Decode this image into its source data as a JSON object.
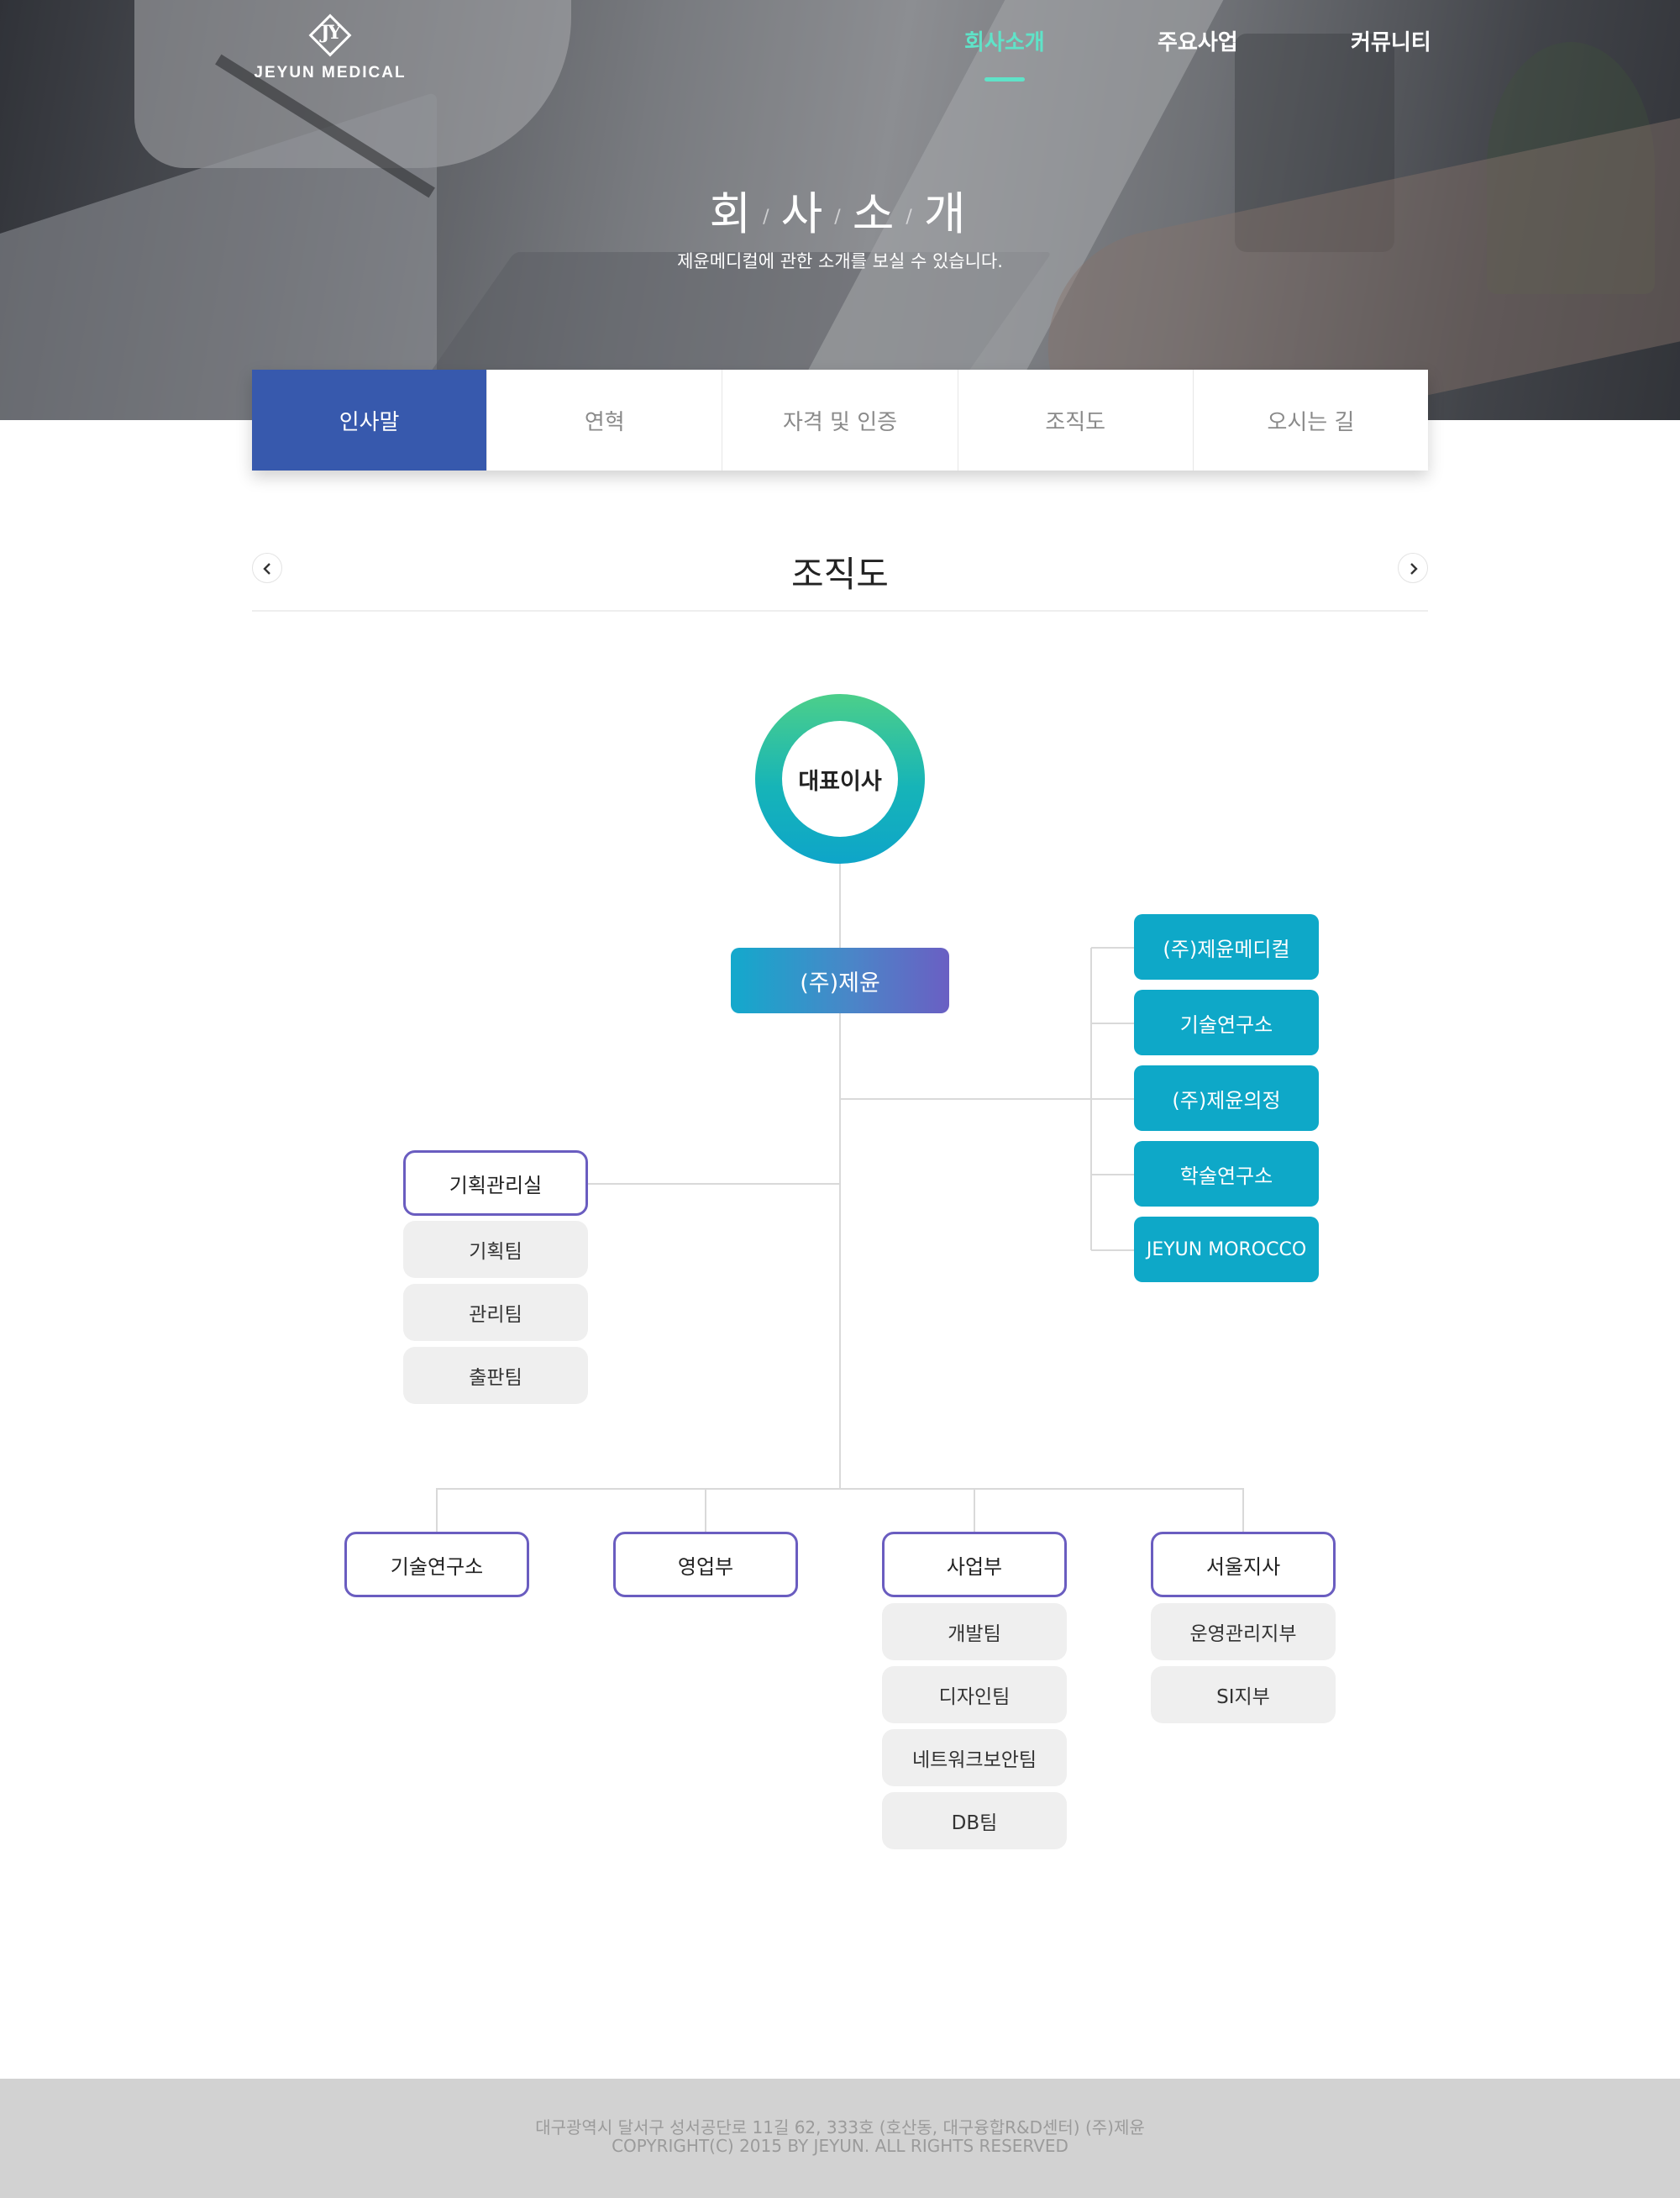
{
  "brand": {
    "logo_mark": "JY",
    "name": "JEYUN MEDICAL"
  },
  "nav": {
    "items": [
      {
        "label": "회사소개",
        "active": true
      },
      {
        "label": "주요사업",
        "active": false
      },
      {
        "label": "커뮤니티",
        "active": false
      }
    ],
    "accent_color": "#5fe3c8"
  },
  "hero": {
    "title_chars": [
      "회",
      "사",
      "소",
      "개"
    ],
    "separator": "/",
    "subtitle": "제윤메디컬에 관한 소개를 보실 수 있습니다."
  },
  "tabs": [
    {
      "label": "인사말",
      "active": true
    },
    {
      "label": "연혁",
      "active": false
    },
    {
      "label": "자격 및 인증",
      "active": false
    },
    {
      "label": "조직도",
      "active": false
    },
    {
      "label": "오시는 길",
      "active": false
    }
  ],
  "section": {
    "title": "조직도",
    "prev_icon": "chevron-left-icon",
    "next_icon": "chevron-right-icon"
  },
  "org": {
    "ceo": "대표이사",
    "main": "(주)제윤",
    "affiliates": [
      "(주)제윤메디컬",
      "기술연구소",
      "(주)제윤의정",
      "학술연구소",
      "JEYUN MOROCCO"
    ],
    "planning": {
      "name": "기획관리실",
      "teams": [
        "기획팀",
        "관리팀",
        "출판팀"
      ]
    },
    "departments": [
      {
        "name": "기술연구소",
        "teams": []
      },
      {
        "name": "영업부",
        "teams": []
      },
      {
        "name": "사업부",
        "teams": [
          "개발팀",
          "디자인팀",
          "네트워크보안팀",
          "DB팀"
        ]
      },
      {
        "name": "서울지사",
        "teams": [
          "운영관리지부",
          "SI지부"
        ]
      }
    ]
  },
  "colors": {
    "tab_active": "#3759ad",
    "affiliate": "#0ea8c8",
    "dept_border": "#6a5dc0",
    "team_bg": "#efefef",
    "footer_bg": "#d2d2d2"
  },
  "footer": {
    "address": "대구광역시 달서구 성서공단로 11길 62, 333호 (호산동, 대구융합R&D센터) (주)제윤",
    "copyright": "COPYRIGHT(C) 2015 BY JEYUN. ALL RIGHTS RESERVED"
  }
}
